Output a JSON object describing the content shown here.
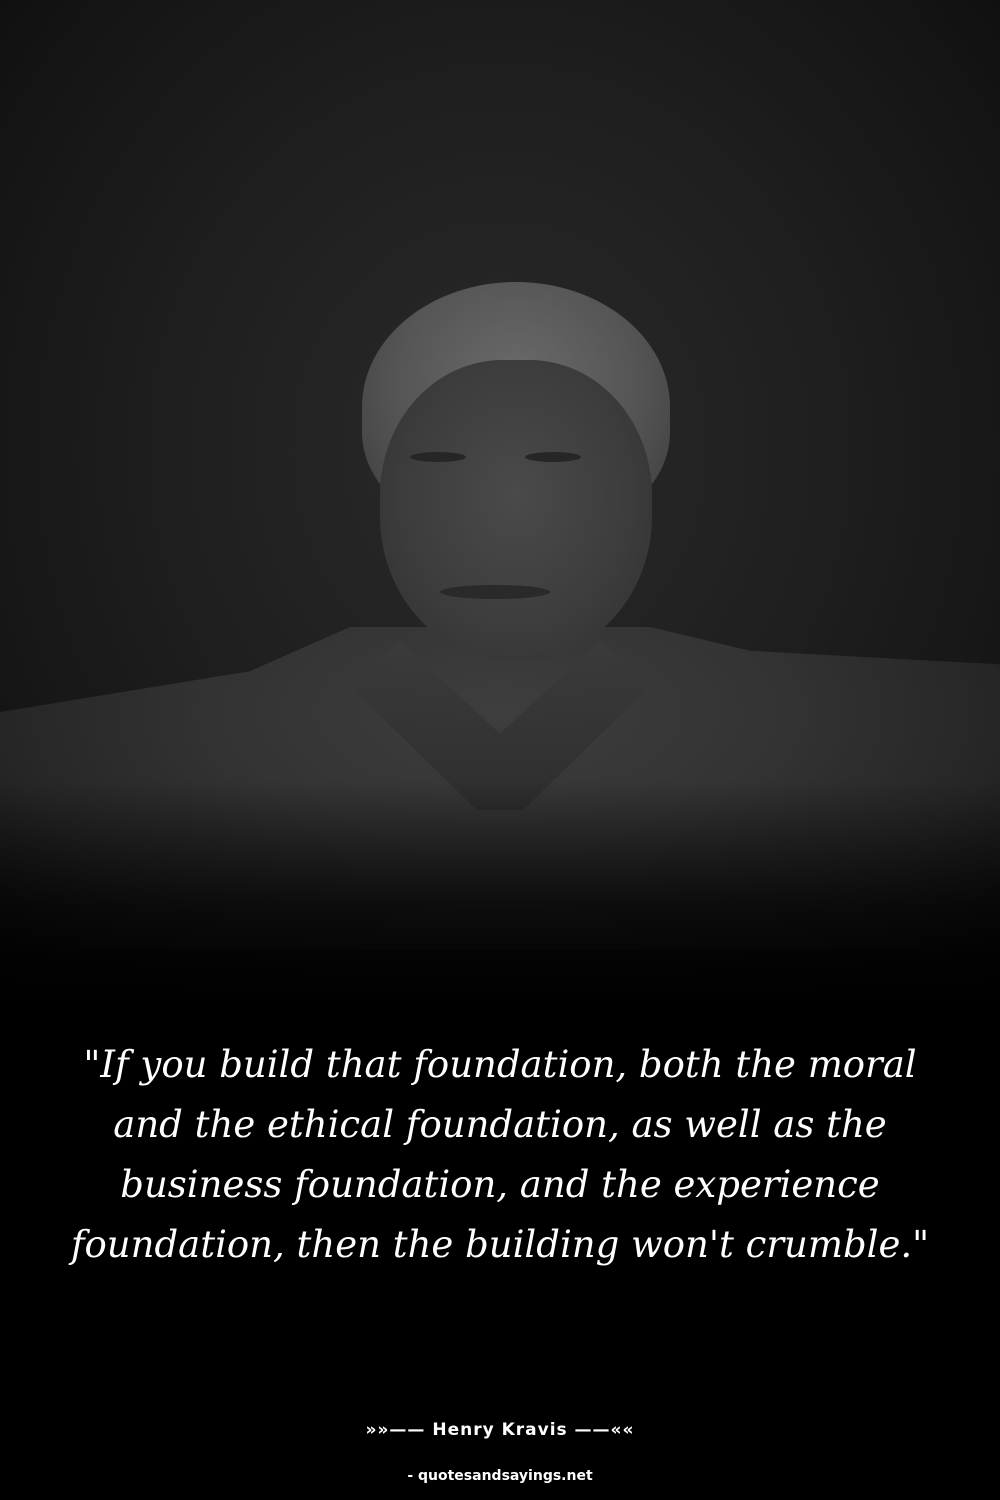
{
  "quote": {
    "text": "\"If you build that foundation, both the moral and the ethical foundation, as well as the business foundation, and the experience foundation, then the building won't crumble.\"",
    "author_line": "»»—— Henry Kravis ——««"
  },
  "source": {
    "text": "- quotesandsayings.net"
  },
  "colors": {
    "background": "#000000",
    "text": "#ffffff"
  }
}
